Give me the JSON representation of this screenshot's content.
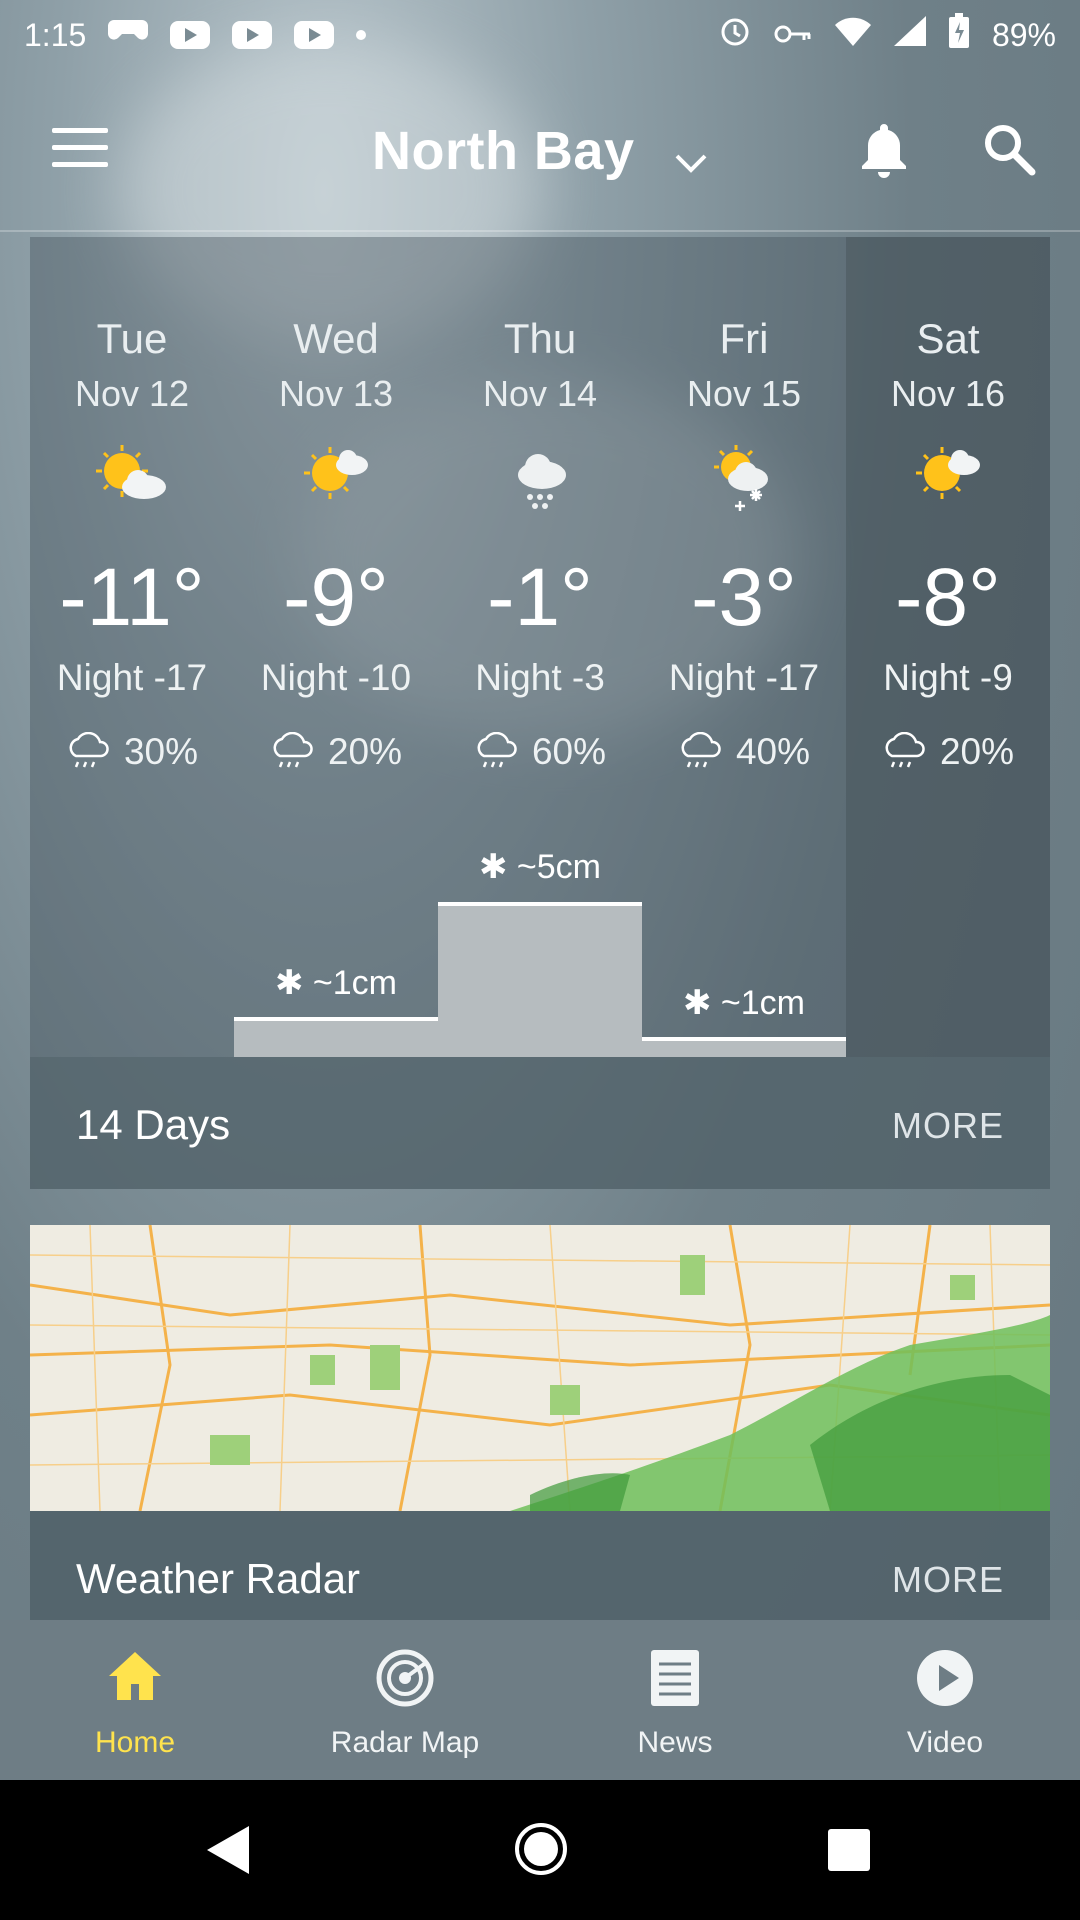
{
  "status_bar": {
    "time": "1:15",
    "battery": "89%"
  },
  "app_bar": {
    "location": "North Bay"
  },
  "forecast": {
    "days": [
      {
        "day": "Tue",
        "date": "Nov 12",
        "icon": "sun-cloud-icon",
        "temp": "-11°",
        "night": "Night -17",
        "precip": "30%"
      },
      {
        "day": "Wed",
        "date": "Nov 13",
        "icon": "sun-cloud-icon",
        "temp": "-9°",
        "night": "Night -10",
        "precip": "20%"
      },
      {
        "day": "Thu",
        "date": "Nov 14",
        "icon": "snow-cloud-icon",
        "temp": "-1°",
        "night": "Night -3",
        "precip": "60%"
      },
      {
        "day": "Fri",
        "date": "Nov 15",
        "icon": "sun-snow-icon",
        "temp": "-3°",
        "night": "Night -17",
        "precip": "40%"
      },
      {
        "day": "Sat",
        "date": "Nov 16",
        "icon": "sun-cloud-icon",
        "temp": "-8°",
        "night": "Night -9",
        "precip": "20%"
      }
    ],
    "snowfall": [
      {
        "day": "Wed",
        "label": "~1cm"
      },
      {
        "day": "Thu",
        "label": "~5cm"
      },
      {
        "day": "Fri",
        "label": "~1cm"
      }
    ],
    "footer_title": "14 Days",
    "footer_more": "MORE"
  },
  "radar": {
    "title": "Weather Radar",
    "more": "MORE"
  },
  "bottom_nav": {
    "items": [
      {
        "label": "Home",
        "icon": "home-icon",
        "active": true
      },
      {
        "label": "Radar Map",
        "icon": "radar-icon",
        "active": false
      },
      {
        "label": "News",
        "icon": "news-icon",
        "active": false
      },
      {
        "label": "Video",
        "icon": "play-icon",
        "active": false
      }
    ]
  },
  "colors": {
    "active_nav": "#ffe34d",
    "snow_bar": "#b6bcbf"
  }
}
